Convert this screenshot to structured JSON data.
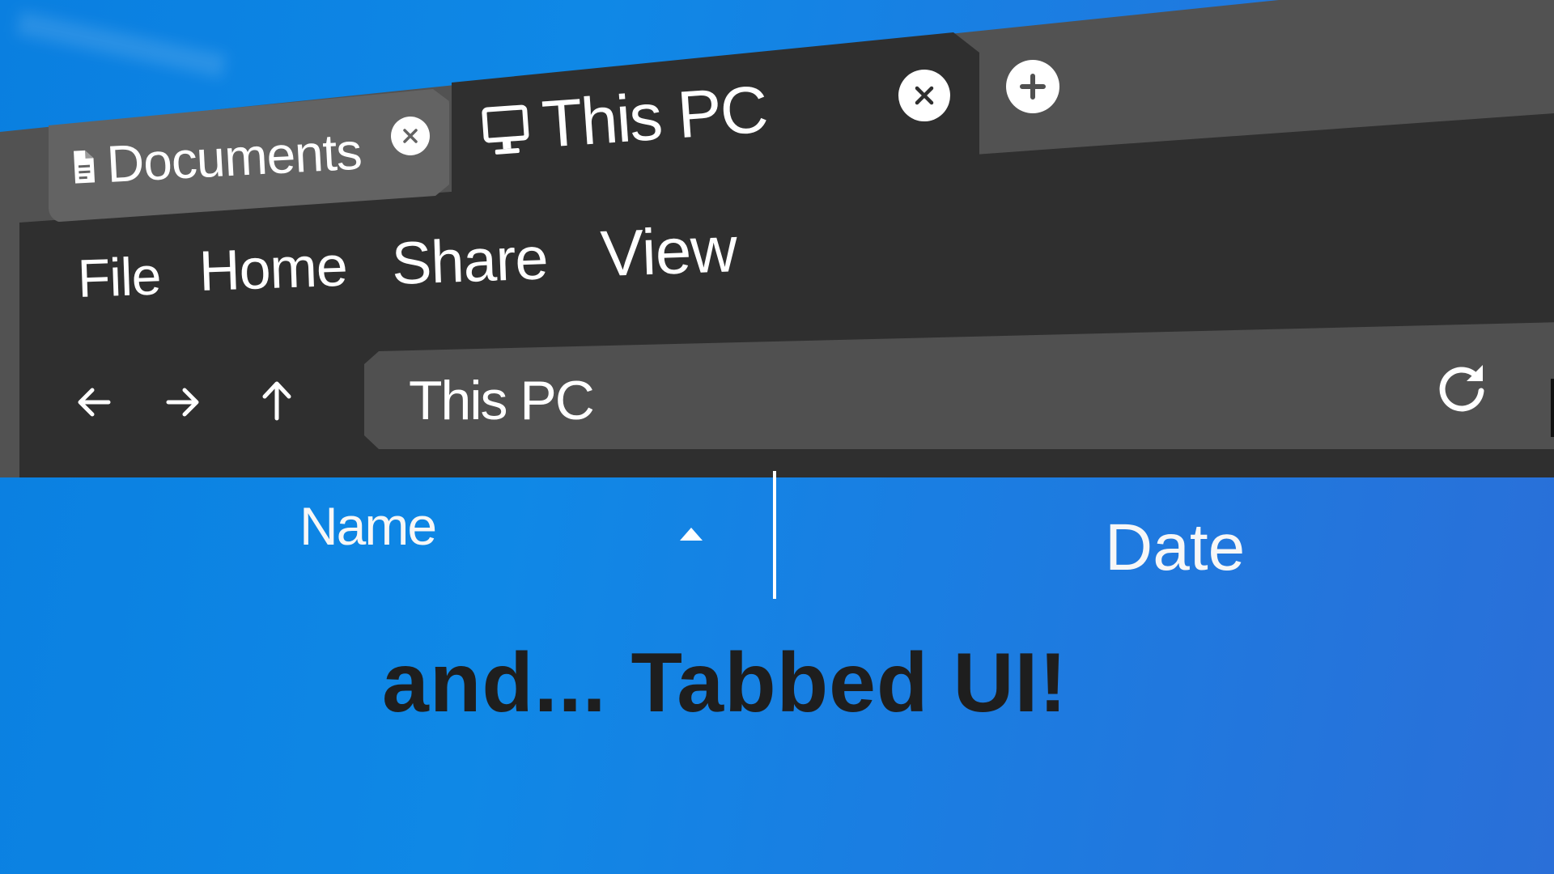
{
  "window": {
    "tabs": [
      {
        "label": "Documents",
        "icon": "document-icon",
        "active": false
      },
      {
        "label": "This PC",
        "icon": "monitor-icon",
        "active": true
      }
    ],
    "new_tab_icon": "plus-icon"
  },
  "ribbon": {
    "items": [
      {
        "label": "File"
      },
      {
        "label": "Home"
      },
      {
        "label": "Share"
      },
      {
        "label": "View"
      }
    ]
  },
  "navigation": {
    "back_icon": "arrow-left-icon",
    "forward_icon": "arrow-right-icon",
    "up_icon": "arrow-up-icon"
  },
  "address_bar": {
    "value": "This PC",
    "refresh_icon": "refresh-icon"
  },
  "file_list": {
    "columns": [
      {
        "label": "Name",
        "sorted": "ascending"
      },
      {
        "label": "Date"
      }
    ]
  },
  "caption": "and... Tabbed UI!",
  "colors": {
    "wallpaper": "#0f88e6",
    "chrome_dark": "#2f2f2f",
    "chrome_mid": "#525252",
    "inactive_tab": "#636363",
    "address_bar": "#505050",
    "content_bg": "#dfdfdf",
    "caption_text": "#1e1e1e"
  }
}
